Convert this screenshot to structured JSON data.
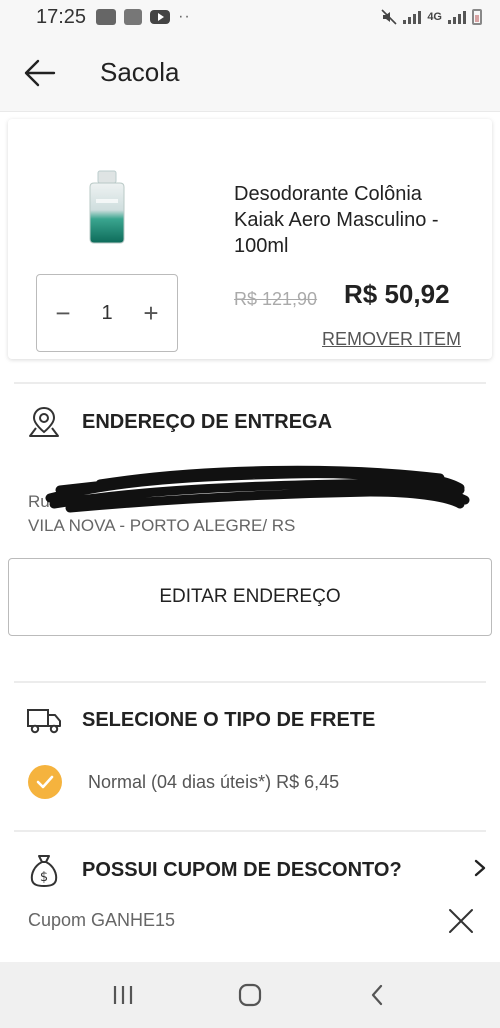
{
  "status_bar": {
    "time": "17:25",
    "network": "4G"
  },
  "header": {
    "title": "Sacola",
    "back_icon": "arrow-left-icon"
  },
  "cart_item": {
    "name": "Desodorante Colônia Kaiak Aero Masculino - 100ml",
    "quantity": "1",
    "minus_label": "−",
    "plus_label": "+",
    "old_price": "R$ 121,90",
    "price": "R$ 50,92",
    "remove_label": "REMOVER ITEM"
  },
  "delivery": {
    "title": "ENDEREÇO DE ENTREGA",
    "icon": "map-pin-icon",
    "address_line1": "Ru",
    "address_line2": "VILA NOVA - PORTO ALEGRE/ RS",
    "edit_label": "EDITAR ENDEREÇO"
  },
  "shipping": {
    "title": "SELECIONE O TIPO DE FRETE",
    "icon": "truck-icon",
    "option_label": "Normal (04 dias úteis*) R$ 6,45"
  },
  "coupon": {
    "title": "POSSUI CUPOM DE DESCONTO?",
    "icon": "money-bag-icon",
    "applied": "Cupom GANHE15"
  },
  "colors": {
    "accent": "#f5b33e",
    "text": "#222222",
    "muted": "#666666"
  }
}
